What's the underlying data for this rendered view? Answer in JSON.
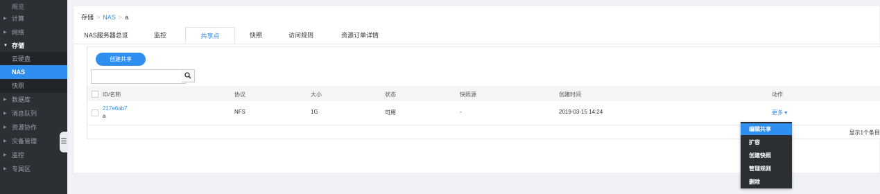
{
  "sidebar": {
    "items": [
      {
        "label": "概览",
        "kind": "top"
      },
      {
        "label": "计算",
        "kind": "collapsed"
      },
      {
        "label": "网络",
        "kind": "collapsed"
      },
      {
        "label": "存储",
        "kind": "expanded"
      },
      {
        "label": "云硬盘",
        "kind": "sub"
      },
      {
        "label": "NAS",
        "kind": "active"
      },
      {
        "label": "快照",
        "kind": "sub"
      },
      {
        "label": "数据库",
        "kind": "collapsed"
      },
      {
        "label": "消息队列",
        "kind": "collapsed"
      },
      {
        "label": "资源协作",
        "kind": "collapsed"
      },
      {
        "label": "灾备管理",
        "kind": "collapsed"
      },
      {
        "label": "监控",
        "kind": "collapsed"
      },
      {
        "label": "专属区",
        "kind": "collapsed"
      }
    ]
  },
  "breadcrumb": {
    "root": "存储",
    "sep": ">",
    "level1": "NAS",
    "level2": "a"
  },
  "tabs": [
    {
      "label": "NAS服务器总览"
    },
    {
      "label": "监控"
    },
    {
      "label": "共享点",
      "active": true
    },
    {
      "label": "快照"
    },
    {
      "label": "访问规则"
    },
    {
      "label": "资源订单详情"
    }
  ],
  "toolbar": {
    "create_label": "创建共享",
    "search_placeholder": ""
  },
  "table": {
    "headers": [
      "ID/名称",
      "协议",
      "大小",
      "状态",
      "快照源",
      "创建时间",
      "动作"
    ],
    "rows": [
      {
        "id": "217e6ab7",
        "name": "a",
        "protocol": "NFS",
        "size": "1G",
        "status": "可用",
        "snapshot": "-",
        "created": "2019-03-15 14:24",
        "action": "更多"
      }
    ]
  },
  "pagination": {
    "text": "显示1个条目"
  },
  "dropdown": {
    "items": [
      {
        "label": "编辑共享",
        "active": true
      },
      {
        "label": "扩容"
      },
      {
        "label": "创建快照"
      },
      {
        "label": "管理规则"
      },
      {
        "label": "删除"
      }
    ]
  },
  "colors": {
    "accent": "#2f8ff0",
    "sidebar": "#2c3034",
    "sidebar_sub": "#212428"
  }
}
